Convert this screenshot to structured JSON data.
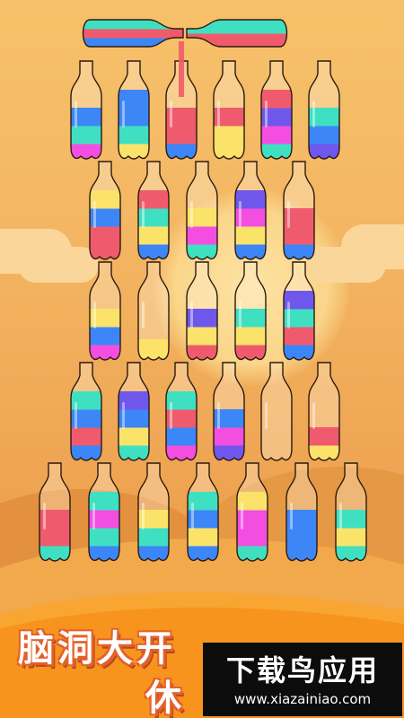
{
  "game": {
    "title_line1": "脑洞大开",
    "title_line2": "休",
    "watermark_text": "下载鸟应用",
    "watermark_url": "www.xiazainiao.com",
    "colors": {
      "pink": "#f34ee0",
      "red": "#ef5b6c",
      "yellow": "#fbe36a",
      "blue": "#3c86f7",
      "teal": "#3fe0c2",
      "purple": "#6f57ec"
    },
    "pouring": {
      "from": {
        "colors": [
          "blue",
          "red",
          "teal"
        ]
      },
      "to": {
        "colors": [
          "red",
          "teal"
        ]
      },
      "stream_color": "red"
    },
    "rows": [
      [
        {
          "layers": [
            "pink",
            "teal",
            "blue",
            null
          ],
          "stream": false
        },
        {
          "layers": [
            "yellow",
            "teal",
            "blue",
            "blue"
          ],
          "stream": false
        },
        {
          "layers": [
            "blue",
            "red",
            "red",
            null
          ],
          "stream": true
        },
        {
          "layers": [
            "yellow",
            "yellow",
            "red",
            null
          ],
          "stream": false
        },
        {
          "layers": [
            "teal",
            "pink",
            "purple",
            "red"
          ],
          "stream": false
        },
        {
          "layers": [
            "purple",
            "blue",
            "teal",
            null
          ],
          "stream": false
        }
      ],
      [
        {
          "layers": [
            "red",
            "red",
            "blue",
            "yellow"
          ],
          "stream": false
        },
        {
          "layers": [
            "blue",
            "yellow",
            "teal",
            "red"
          ],
          "stream": false
        },
        {
          "layers": [
            "teal",
            "pink",
            "yellow",
            null
          ],
          "stream": false
        },
        {
          "layers": [
            "blue",
            "yellow",
            "pink",
            "purple"
          ],
          "stream": false
        },
        {
          "layers": [
            "blue",
            "red",
            "red",
            null
          ],
          "stream": false
        }
      ],
      [
        {
          "layers": [
            "pink",
            "blue",
            "yellow",
            null
          ],
          "stream": false
        },
        {
          "layers": [
            "yellow",
            null,
            null,
            null
          ],
          "stream": false
        },
        {
          "layers": [
            "red",
            "yellow",
            "purple",
            null
          ],
          "stream": false
        },
        {
          "layers": [
            "red",
            "yellow",
            "teal",
            null
          ],
          "stream": false
        },
        {
          "layers": [
            "blue",
            "red",
            "teal",
            "purple"
          ],
          "stream": false
        }
      ],
      [
        {
          "layers": [
            "blue",
            "red",
            "blue",
            "teal"
          ],
          "stream": false
        },
        {
          "layers": [
            "teal",
            "yellow",
            "blue",
            "purple"
          ],
          "stream": false
        },
        {
          "layers": [
            "pink",
            "blue",
            "red",
            "teal"
          ],
          "stream": false
        },
        {
          "layers": [
            "purple",
            "pink",
            "blue",
            null
          ],
          "stream": false
        },
        {
          "layers": [
            null,
            null,
            null,
            null
          ],
          "stream": false
        },
        {
          "layers": [
            "yellow",
            "red",
            null,
            null
          ],
          "stream": false
        }
      ],
      [
        {
          "layers": [
            "teal",
            "red",
            "red",
            null
          ],
          "stream": false
        },
        {
          "layers": [
            "blue",
            "teal",
            "pink",
            "teal"
          ],
          "stream": false
        },
        {
          "layers": [
            "blue",
            "teal",
            "yellow",
            null
          ],
          "stream": false
        },
        {
          "layers": [
            "blue",
            "yellow",
            "blue",
            "teal"
          ],
          "stream": false
        },
        {
          "layers": [
            "teal",
            "pink",
            "pink",
            "yellow"
          ],
          "stream": false
        },
        {
          "layers": [
            "blue",
            "blue",
            "blue",
            null
          ],
          "stream": false
        },
        {
          "layers": [
            "teal",
            "yellow",
            "teal",
            null
          ],
          "stream": false
        }
      ]
    ]
  }
}
